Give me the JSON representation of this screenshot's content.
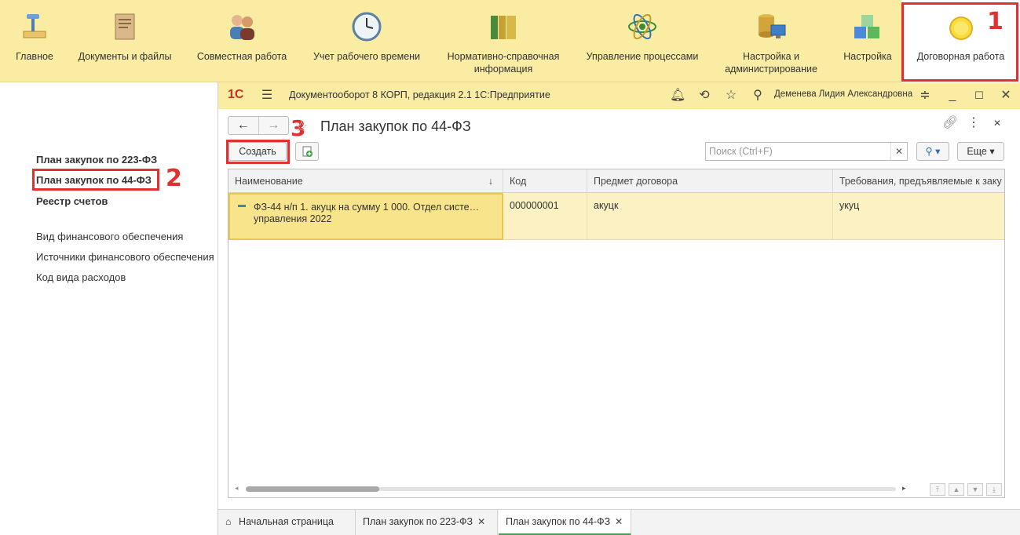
{
  "sections": [
    {
      "label": "Главное",
      "icon": "desk-lamp-icon"
    },
    {
      "label": "Документы и файлы",
      "icon": "document-folder-icon"
    },
    {
      "label": "Совместная работа",
      "icon": "users-icon"
    },
    {
      "label": "Учет рабочего времени",
      "icon": "clock-icon"
    },
    {
      "label": "Нормативно-справочная информация",
      "icon": "binders-icon"
    },
    {
      "label": "Управление процессами",
      "icon": "process-atom-icon"
    },
    {
      "label": "Настройка и администрирование",
      "icon": "database-computer-icon"
    },
    {
      "label": "Настройка",
      "icon": "cubes-icon"
    },
    {
      "label": "Договорная работа",
      "icon": "yellow-circle-icon"
    }
  ],
  "markers": {
    "one": "1",
    "two": "2",
    "three": "3"
  },
  "left_panel": {
    "items": [
      {
        "label": "План закупок по 223-ФЗ"
      },
      {
        "label": "План закупок по 44-ФЗ"
      },
      {
        "label": "Реестр счетов"
      }
    ],
    "secondary": [
      {
        "label": "Вид финансового обеспечения"
      },
      {
        "label": "Источники финансового обеспечения"
      },
      {
        "label": "Код вида расходов"
      }
    ]
  },
  "window": {
    "logo": "1С",
    "title": "Документооборот 8 КОРП, редакция 2.1 1С:Предприятие",
    "user": "Деменева Лидия Александровна"
  },
  "form": {
    "title": "План закупок по 44-ФЗ",
    "create_label": "Создать",
    "search_placeholder": "Поиск (Ctrl+F)",
    "more_label": "Еще",
    "columns": [
      "Наименование",
      "Код",
      "Предмет договора",
      "Требования, предъявляемые к заку"
    ],
    "rows": [
      {
        "name_line1": "ФЗ-44 н/п 1. акуцк на сумму 1 000. Отдел систе…",
        "name_line2": "управления 2022",
        "code": "000000001",
        "subject": "акуцк",
        "requirements": "укуц"
      }
    ]
  },
  "tabs": [
    {
      "label": "Начальная страница"
    },
    {
      "label": "План закупок по 223-ФЗ"
    },
    {
      "label": "План закупок по 44-ФЗ"
    }
  ],
  "colors": {
    "toolbar_bg": "#fbeca4",
    "highlight_red": "#e03030",
    "selected_row": "#fbf1c2"
  }
}
